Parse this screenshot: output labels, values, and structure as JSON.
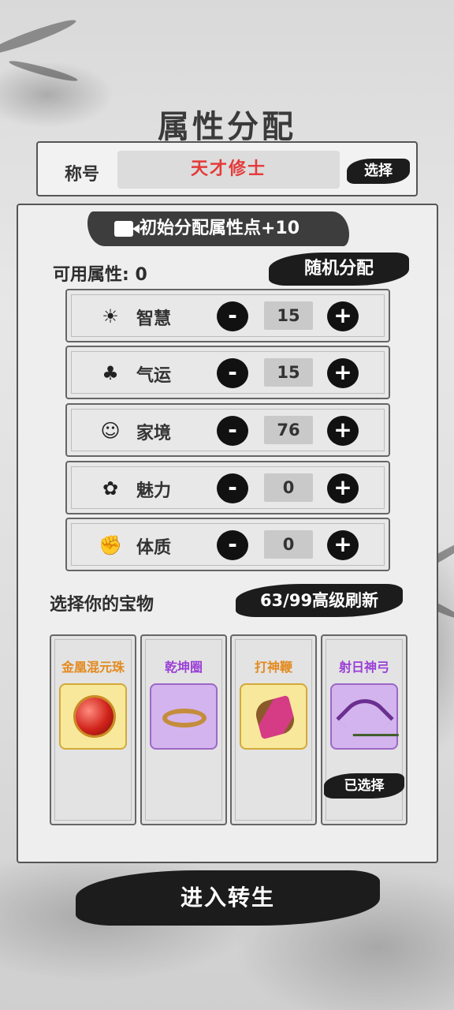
{
  "page_title": "属性分配",
  "title_row": {
    "label": "称号",
    "value": "天才修士",
    "select_label": "选择"
  },
  "ad_bonus": {
    "icon": "video-camera-icon",
    "label": "初始分配属性点+10"
  },
  "available": {
    "text": "可用属性: 0"
  },
  "random_label": "随机分配",
  "attributes": [
    {
      "label": "智慧",
      "value": "15",
      "icon": "lightbulb-icon"
    },
    {
      "label": "气运",
      "value": "15",
      "icon": "clover-icon"
    },
    {
      "label": "家境",
      "value": "76",
      "icon": "family-icon"
    },
    {
      "label": "魅力",
      "value": "0",
      "icon": "flower-icon"
    },
    {
      "label": "体质",
      "value": "0",
      "icon": "muscle-icon"
    }
  ],
  "stepper": {
    "minus": "-",
    "plus": "+"
  },
  "treasure": {
    "title": "选择你的宝物",
    "refresh_label": "63/99高级刷新",
    "items": [
      {
        "name": "金凰混元珠",
        "rarity": "gold"
      },
      {
        "name": "乾坤圈",
        "rarity": "purple"
      },
      {
        "name": "打神鞭",
        "rarity": "gold"
      },
      {
        "name": "射日神弓",
        "rarity": "purple",
        "badge": "已选择"
      }
    ]
  },
  "enter_label": "进入转生",
  "colors": {
    "title_red": "#e53a3a",
    "gold_text": "#e38a1e",
    "purple_text": "#9a3fd6",
    "ink": "#1c1c1c"
  }
}
